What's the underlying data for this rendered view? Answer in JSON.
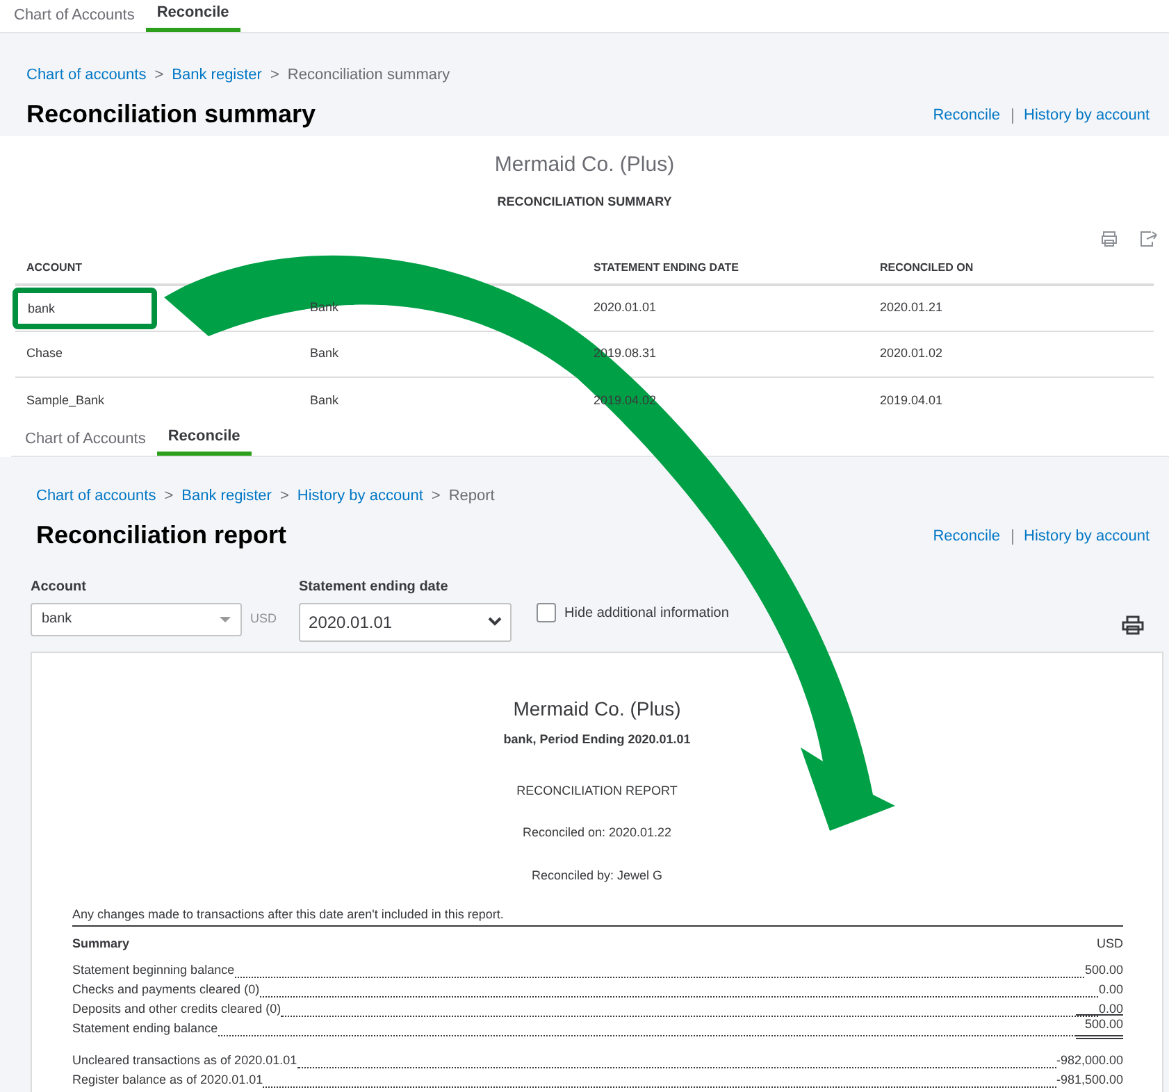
{
  "summary_screen": {
    "tabs": [
      {
        "label": "Chart of Accounts",
        "selected": false
      },
      {
        "label": "Reconcile",
        "selected": true
      }
    ],
    "breadcrumbs": [
      {
        "label": "Chart of accounts",
        "separator": ">"
      },
      {
        "label": "Bank register",
        "separator": ">"
      }
    ],
    "breadcrumb_current": "Reconciliation summary",
    "title": "Reconciliation summary",
    "header_links": [
      "Reconcile",
      "History by account"
    ],
    "company": "Mermaid Co. (Plus)",
    "report_title": "RECONCILIATION SUMMARY",
    "table": {
      "columns": [
        "ACCOUNT",
        "",
        "STATEMENT ENDING DATE",
        "RECONCILED ON"
      ],
      "rows": [
        {
          "cells": [
            "bank",
            "Bank",
            "2020.01.01",
            "2020.01.21"
          ],
          "highlighted": true
        },
        {
          "cells": [
            "Chase",
            "Bank",
            "2019.08.31",
            "2020.01.02"
          ],
          "highlighted": false
        },
        {
          "cells": [
            "Sample_Bank",
            "Bank",
            "2019.04.02",
            "2019.04.01"
          ],
          "highlighted": false
        }
      ]
    }
  },
  "report_screen": {
    "tabs": [
      {
        "label": "Chart of Accounts",
        "selected": false
      },
      {
        "label": "Reconcile",
        "selected": true
      }
    ],
    "breadcrumbs": [
      {
        "label": "Chart of accounts",
        "separator": ">"
      },
      {
        "label": "Bank register",
        "separator": ">"
      },
      {
        "label": "History by account",
        "separator": ">"
      }
    ],
    "breadcrumb_current": "Report",
    "title": "Reconciliation report",
    "header_links": [
      "Reconcile",
      "History by account"
    ],
    "account_field": {
      "label": "Account",
      "value": "bank",
      "currency": "USD"
    },
    "date_field": {
      "label": "Statement ending date",
      "value": "2020.01.01"
    },
    "hide_info": {
      "label": "Hide additional information",
      "checked": false
    },
    "report": {
      "company": "Mermaid Co. (Plus)",
      "subtitle": "bank, Period Ending 2020.01.01",
      "title": "RECONCILIATION REPORT",
      "reconciled_on": "Reconciled on: 2020.01.22",
      "reconciled_by": "Reconciled by: Jewel G",
      "note": "Any changes made to transactions after this date aren't included in this report.",
      "summary_label": "Summary",
      "currency": "USD",
      "lines": [
        {
          "label": "Statement beginning balance",
          "value": "500.00",
          "kind": "plain"
        },
        {
          "label": "Checks and payments cleared (0)",
          "value": "0.00",
          "kind": "plain"
        },
        {
          "label": "Deposits and other credits cleared (0)",
          "value": "0.00",
          "kind": "plain"
        },
        {
          "label": "Statement ending balance",
          "value": "500.00",
          "kind": "total"
        },
        {
          "label": "Uncleared transactions as of 2020.01.01",
          "value": "-982,000.00",
          "kind": "spaced"
        },
        {
          "label": "Register balance as of 2020.01.01",
          "value": "-981,500.00",
          "kind": "plain"
        }
      ]
    }
  }
}
